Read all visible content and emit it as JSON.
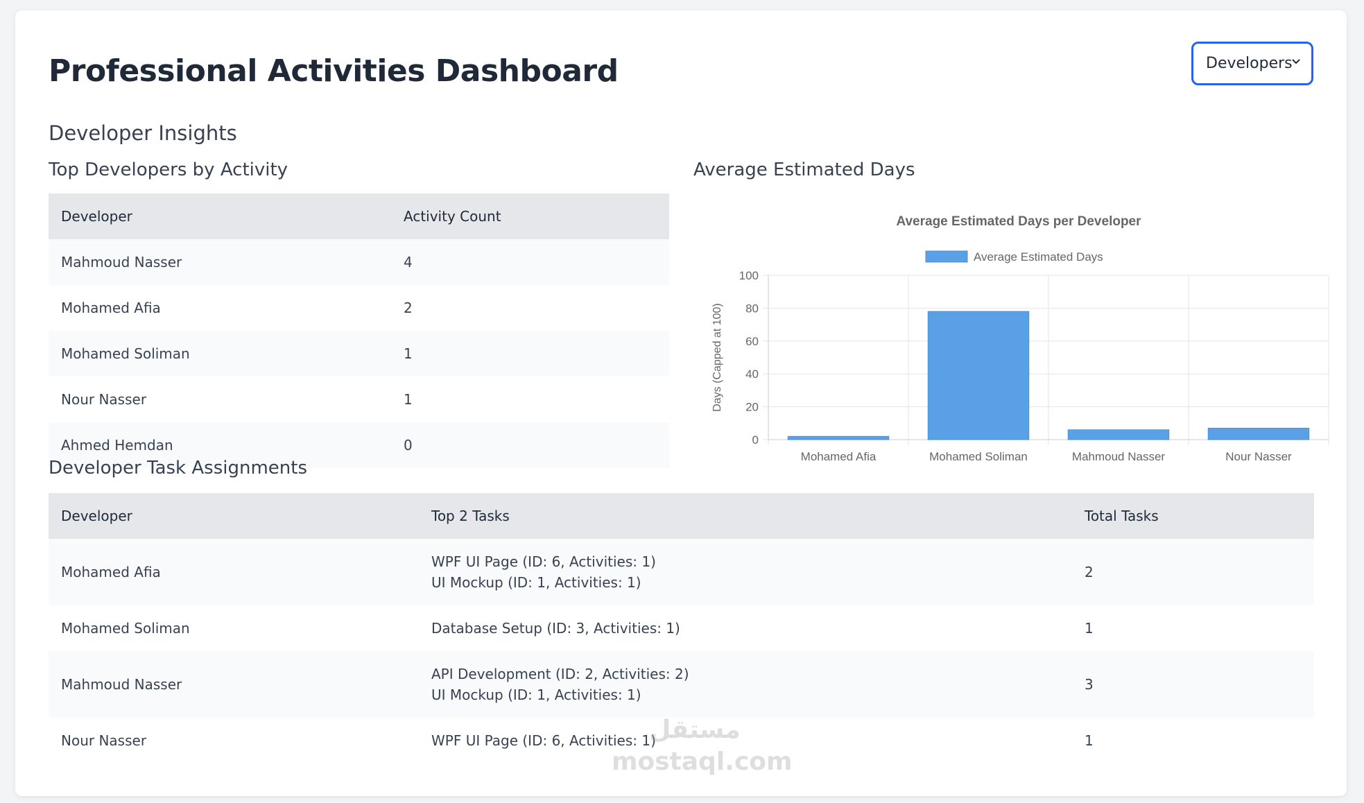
{
  "header": {
    "title": "Professional Activities Dashboard",
    "view_select": {
      "value": "Developers",
      "options": [
        "Developers"
      ]
    }
  },
  "section_title": "Developer Insights",
  "top_developers": {
    "title": "Top Developers by Activity",
    "columns": [
      "Developer",
      "Activity Count"
    ],
    "rows": [
      [
        "Mahmoud Nasser",
        "4"
      ],
      [
        "Mohamed Afia",
        "2"
      ],
      [
        "Mohamed Soliman",
        "1"
      ],
      [
        "Nour Nasser",
        "1"
      ],
      [
        "Ahmed Hemdan",
        "0"
      ]
    ]
  },
  "avg_days": {
    "title": "Average Estimated Days"
  },
  "chart_data": {
    "type": "bar",
    "title": "Average Estimated Days per Developer",
    "categories": [
      "Mohamed Afia",
      "Mohamed Soliman",
      "Mahmoud Nasser",
      "Nour Nasser"
    ],
    "series": [
      {
        "name": "Average Estimated Days",
        "values": [
          2,
          78,
          6,
          7
        ],
        "color": "#5aa0e6"
      }
    ],
    "xlabel": "",
    "ylabel": "Days (Capped at 100)",
    "ylim": [
      0,
      100
    ],
    "yticks": [
      0,
      20,
      40,
      60,
      80,
      100
    ],
    "grid": true,
    "legend": "top-center"
  },
  "task_assignments": {
    "title": "Developer Task Assignments",
    "columns": [
      "Developer",
      "Top 2 Tasks",
      "Total Tasks"
    ],
    "rows": [
      {
        "developer": "Mohamed Afia",
        "tasks": [
          "WPF UI Page (ID: 6, Activities: 1)",
          "UI Mockup (ID: 1, Activities: 1)"
        ],
        "total": "2"
      },
      {
        "developer": "Mohamed Soliman",
        "tasks": [
          "Database Setup (ID: 3, Activities: 1)"
        ],
        "total": "1"
      },
      {
        "developer": "Mahmoud Nasser",
        "tasks": [
          "API Development (ID: 2, Activities: 2)",
          "UI Mockup (ID: 1, Activities: 1)"
        ],
        "total": "3"
      },
      {
        "developer": "Nour Nasser",
        "tasks": [
          "WPF UI Page (ID: 6, Activities: 1)"
        ],
        "total": "1"
      }
    ]
  },
  "watermark": {
    "arabic": "مستقل",
    "latin": "mostaql.com"
  },
  "colors": {
    "accent": "#2563eb",
    "bar": "#5aa0e6",
    "header_bg": "#e5e7eb"
  }
}
